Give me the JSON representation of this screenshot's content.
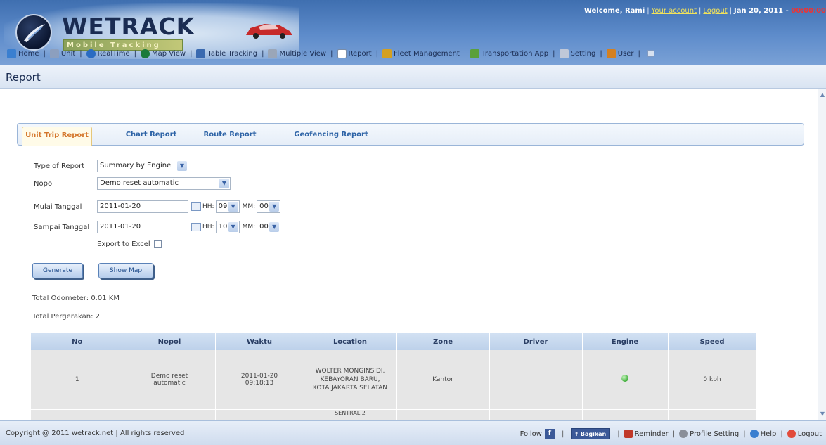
{
  "header": {
    "brand_name": "WETRACK",
    "brand_tagline": "Mobile Tracking",
    "welcome": "Welcome, Rami",
    "your_account": "Your account",
    "logout_link": "Logout",
    "date": "Jan 20, 2011 -"
  },
  "nav": {
    "items": [
      {
        "label": "Home",
        "color": "#3a7fd0"
      },
      {
        "label": "Unit",
        "color": "#8c9fbe"
      },
      {
        "label": "RealTime",
        "color": "#2a6cc2"
      },
      {
        "label": "Map View",
        "color": "#1a7a3a"
      },
      {
        "label": "Table Tracking",
        "color": "#3a6ab0"
      },
      {
        "label": "Multiple View",
        "color": "#9aa6b8"
      },
      {
        "label": "Report",
        "color": "#ffffff"
      },
      {
        "label": "Fleet Management",
        "color": "#d4a020"
      },
      {
        "label": "Transportation App",
        "color": "#5aa03a"
      },
      {
        "label": "Setting",
        "color": "#c0c8d8"
      },
      {
        "label": "User",
        "color": "#d48020"
      }
    ]
  },
  "page": {
    "title": "Report"
  },
  "tabs": [
    {
      "label": "Unit Trip Report",
      "active": true
    },
    {
      "label": "Chart Report",
      "active": false
    },
    {
      "label": "Route Report",
      "active": false
    },
    {
      "label": "Geofencing Report",
      "active": false
    }
  ],
  "form": {
    "type_label": "Type of Report",
    "type_value": "Summary by Engine",
    "nopol_label": "Nopol",
    "nopol_value": "Demo reset automatic",
    "start_label": "Mulai Tanggal",
    "start_date": "2011-01-20",
    "start_hh_label": "HH:",
    "start_hh": "09",
    "start_mm_label": "MM:",
    "start_mm": "00",
    "end_label": "Sampai Tanggal",
    "end_date": "2011-01-20",
    "end_hh_label": "HH:",
    "end_hh": "10",
    "end_mm_label": "MM:",
    "end_mm": "00",
    "export_label": "Export to Excel"
  },
  "buttons": {
    "generate": "Generate",
    "show_map": "Show Map"
  },
  "stats": {
    "odometer": "Total Odometer: 0.01 KM",
    "movements": "Total Pergerakan: 2"
  },
  "table": {
    "headers": [
      "No",
      "Nopol",
      "Waktu",
      "Location",
      "Zone",
      "Driver",
      "Engine",
      "Speed"
    ],
    "rows": [
      {
        "no": "1",
        "nopol": "Demo reset automatic",
        "waktu": "2011-01-20 09:18:13",
        "location": "WOLTER MONGINSIDI, KEBAYORAN BARU, KOTA JAKARTA SELATAN",
        "zone": "Kantor",
        "driver": "",
        "engine": "on",
        "speed": "0 kph"
      }
    ],
    "partial_row_text": "SENTRAL 2"
  },
  "footer": {
    "copyright": "Copyright @ 2011 wetrack.net | All rights reserved",
    "follow": "Follow",
    "facebook_share": "Bagikan",
    "reminder": "Reminder",
    "profile_setting": "Profile Setting",
    "help": "Help",
    "logout": "Logout"
  }
}
